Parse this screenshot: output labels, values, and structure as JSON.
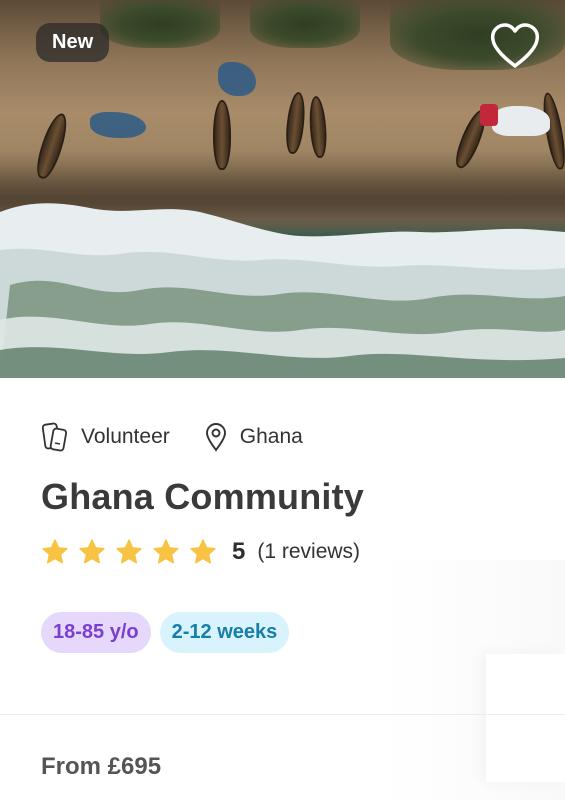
{
  "card": {
    "badge": "New",
    "type_label": "Volunteer",
    "location": "Ghana",
    "title": "Ghana Community",
    "rating_value": "5",
    "rating_stars": 5,
    "reviews_text": "(1 reviews)",
    "age_tag": "18-85 y/o",
    "duration_tag": "2-12 weeks",
    "price_text": "From £695"
  },
  "icons": {
    "favorite": "heart-icon",
    "type": "phone-icon",
    "location": "map-pin-icon",
    "star": "star-icon"
  },
  "colors": {
    "star": "#f8c242",
    "age_tag_bg": "#e5d8fb",
    "age_tag_text": "#7a3fcf",
    "duration_tag_bg": "#d8f3fb",
    "duration_tag_text": "#167ea8",
    "title": "#3a3a3a"
  }
}
